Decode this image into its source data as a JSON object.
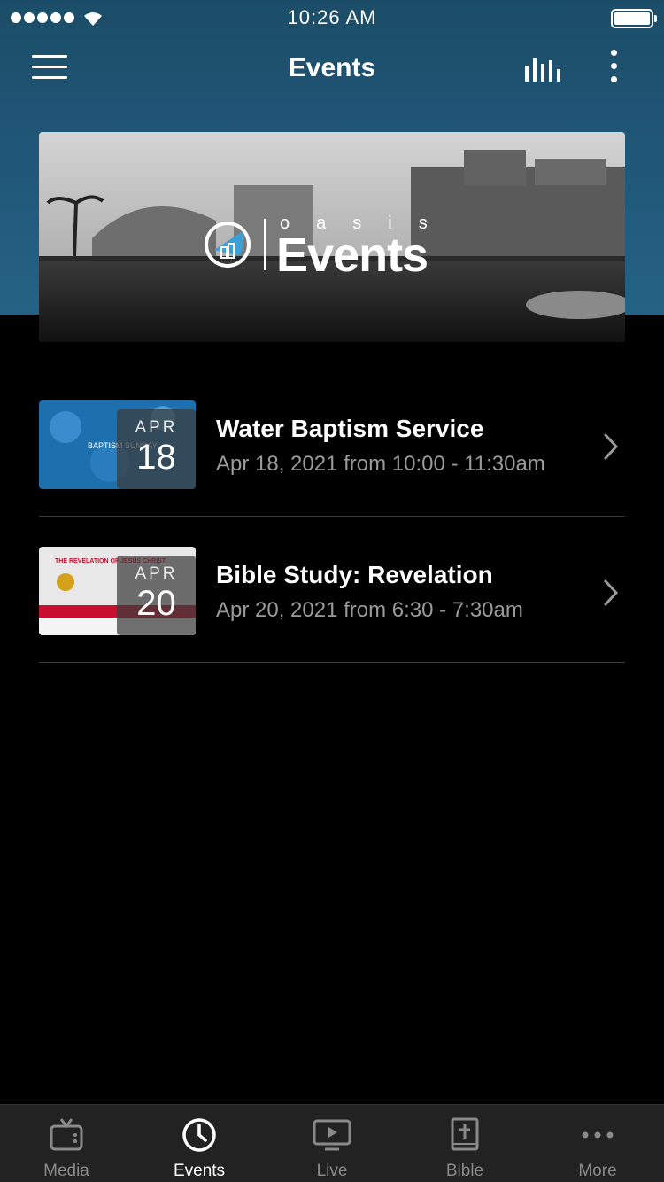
{
  "status_bar": {
    "time": "10:26 AM"
  },
  "nav": {
    "title": "Events"
  },
  "banner": {
    "brand_small": "oasis",
    "brand_large": "Events"
  },
  "events": [
    {
      "title": "Water Baptism Service",
      "subtitle": "Apr 18, 2021 from 10:00 - 11:30am",
      "month": "APR",
      "day": "18",
      "thumb_text": "BAPTISM SUNDAY"
    },
    {
      "title": "Bible Study: Revelation",
      "subtitle": "Apr 20, 2021 from 6:30 - 7:30am",
      "month": "APR",
      "day": "20",
      "thumb_text": "THE REVELATION OF JESUS CHRIST"
    }
  ],
  "tabs": [
    {
      "label": "Media",
      "icon": "tv-icon",
      "active": false
    },
    {
      "label": "Events",
      "icon": "clock-icon",
      "active": true
    },
    {
      "label": "Live",
      "icon": "play-screen-icon",
      "active": false
    },
    {
      "label": "Bible",
      "icon": "bible-icon",
      "active": false
    },
    {
      "label": "More",
      "icon": "ellipsis-icon",
      "active": false
    }
  ],
  "colors": {
    "header": "#21587a",
    "background": "#000000",
    "tab_bar": "#222222",
    "subtitle": "#9a9a9a"
  }
}
